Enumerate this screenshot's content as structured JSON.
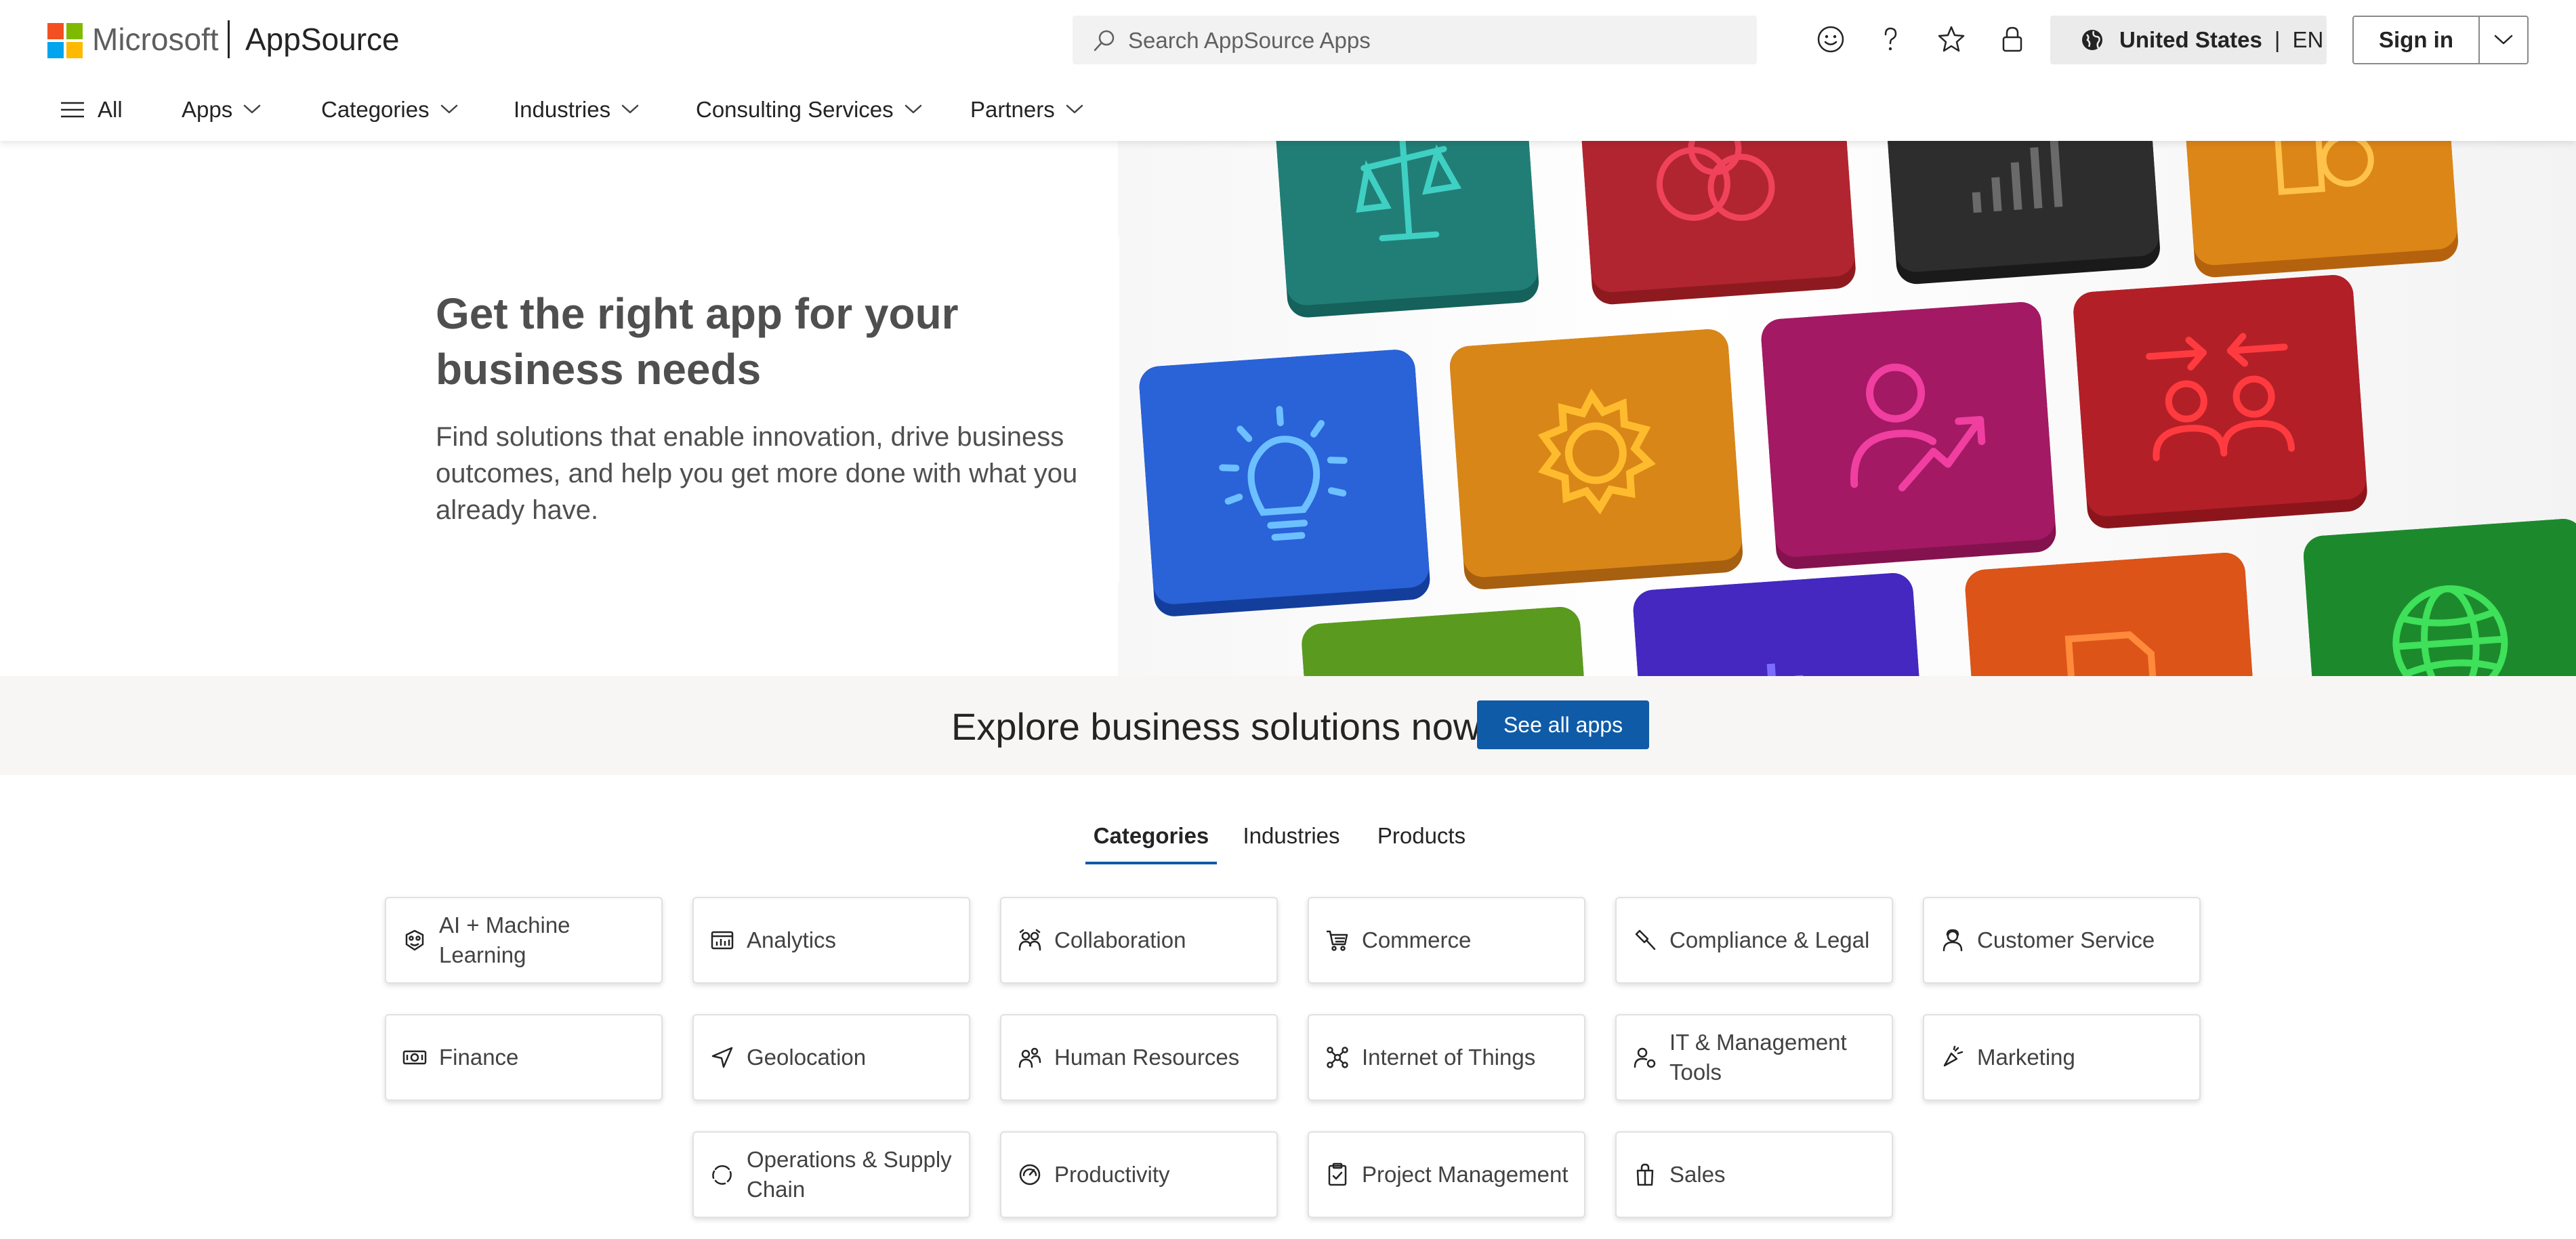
{
  "header": {
    "brand_ms": "Microsoft",
    "brand_app": "AppSource",
    "search_placeholder": "Search AppSource Apps",
    "icons": [
      "feedback-smiley-icon",
      "help-icon",
      "favorites-star-icon",
      "privacy-lock-icon"
    ],
    "region": {
      "country": "United States",
      "separator": "|",
      "language": "EN"
    },
    "signin_label": "Sign in"
  },
  "nav": {
    "all_label": "All",
    "items": [
      "Apps",
      "Categories",
      "Industries",
      "Consulting Services",
      "Partners"
    ]
  },
  "hero": {
    "title": "Get the right app for your business needs",
    "subtitle": "Find solutions that enable innovation, drive business outcomes, and help you get more done with what you already have."
  },
  "explore": {
    "text": "Explore business solutions now",
    "button": "See all apps"
  },
  "tabs": [
    {
      "label": "Categories",
      "active": true
    },
    {
      "label": "Industries",
      "active": false
    },
    {
      "label": "Products",
      "active": false
    }
  ],
  "categories": [
    {
      "label": "AI + Machine Learning",
      "icon": "ai-brain-icon"
    },
    {
      "label": "Analytics",
      "icon": "analytics-chart-icon"
    },
    {
      "label": "Collaboration",
      "icon": "collaboration-people-icon"
    },
    {
      "label": "Commerce",
      "icon": "shopping-cart-icon"
    },
    {
      "label": "Compliance & Legal",
      "icon": "gavel-icon"
    },
    {
      "label": "Customer Service",
      "icon": "person-support-icon"
    },
    {
      "label": "Finance",
      "icon": "money-icon"
    },
    {
      "label": "Geolocation",
      "icon": "location-arrow-icon"
    },
    {
      "label": "Human Resources",
      "icon": "people-icon"
    },
    {
      "label": "Internet of Things",
      "icon": "network-nodes-icon"
    },
    {
      "label": "IT & Management Tools",
      "icon": "person-settings-icon"
    },
    {
      "label": "Marketing",
      "icon": "megaphone-icon"
    },
    {
      "label": "Operations & Supply Chain",
      "icon": "cycle-arrows-icon"
    },
    {
      "label": "Productivity",
      "icon": "gauge-icon"
    },
    {
      "label": "Project Management",
      "icon": "clipboard-icon"
    },
    {
      "label": "Sales",
      "icon": "shopping-bag-icon"
    }
  ],
  "colors": {
    "accent_blue": "#0f5ba7",
    "ms_red": "#f25022",
    "ms_green": "#7fba00",
    "ms_blue": "#00a4ef",
    "ms_yellow": "#ffb900"
  }
}
